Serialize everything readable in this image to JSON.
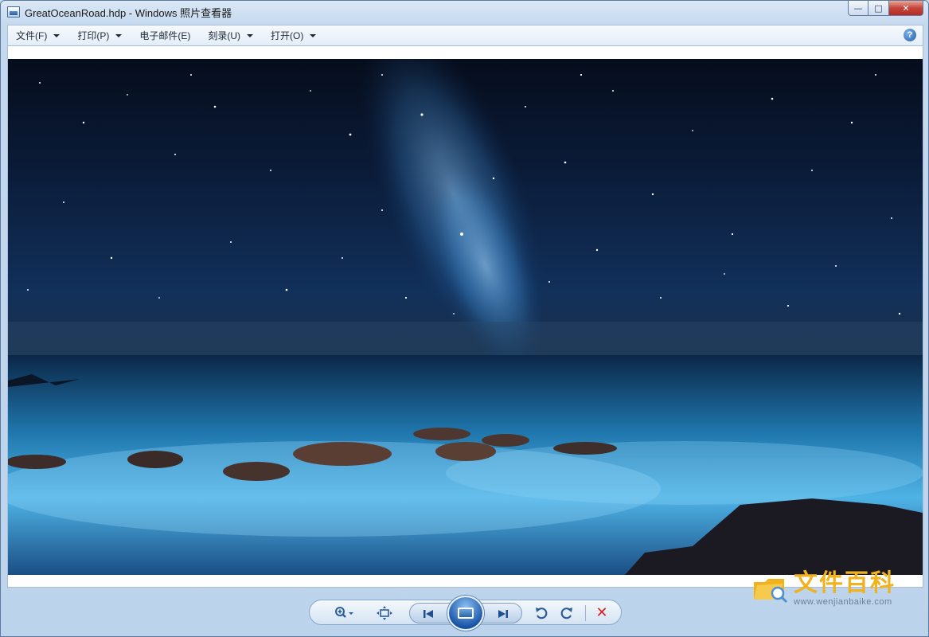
{
  "window": {
    "title": "GreatOceanRoad.hdp - Windows 照片查看器",
    "controls": {
      "minimize": "—",
      "maximize": "□",
      "close": "✕"
    }
  },
  "menu": {
    "items": [
      {
        "label": "文件(F)",
        "has_dropdown": true
      },
      {
        "label": "打印(P)",
        "has_dropdown": true
      },
      {
        "label": "电子邮件(E)",
        "has_dropdown": false
      },
      {
        "label": "刻录(U)",
        "has_dropdown": true
      },
      {
        "label": "打开(O)",
        "has_dropdown": true
      }
    ],
    "help_icon": "?"
  },
  "photo": {
    "subject": "night-sky-milky-way-over-ocean-rocks"
  },
  "toolbar": {
    "zoom_icon": "zoom-icon",
    "fit_icon": "actual-size-icon",
    "prev_icon": "previous-icon",
    "slideshow_icon": "slideshow-icon",
    "next_icon": "next-icon",
    "rotate_ccw_icon": "rotate-ccw-icon",
    "rotate_cw_icon": "rotate-cw-icon",
    "delete_icon": "✕"
  },
  "watermark": {
    "title": "文件百科",
    "url": "www.wenjianbaike.com"
  },
  "colors": {
    "accent": "#2b5c9e",
    "delete": "#d42222",
    "watermark": "#f0b21d"
  }
}
